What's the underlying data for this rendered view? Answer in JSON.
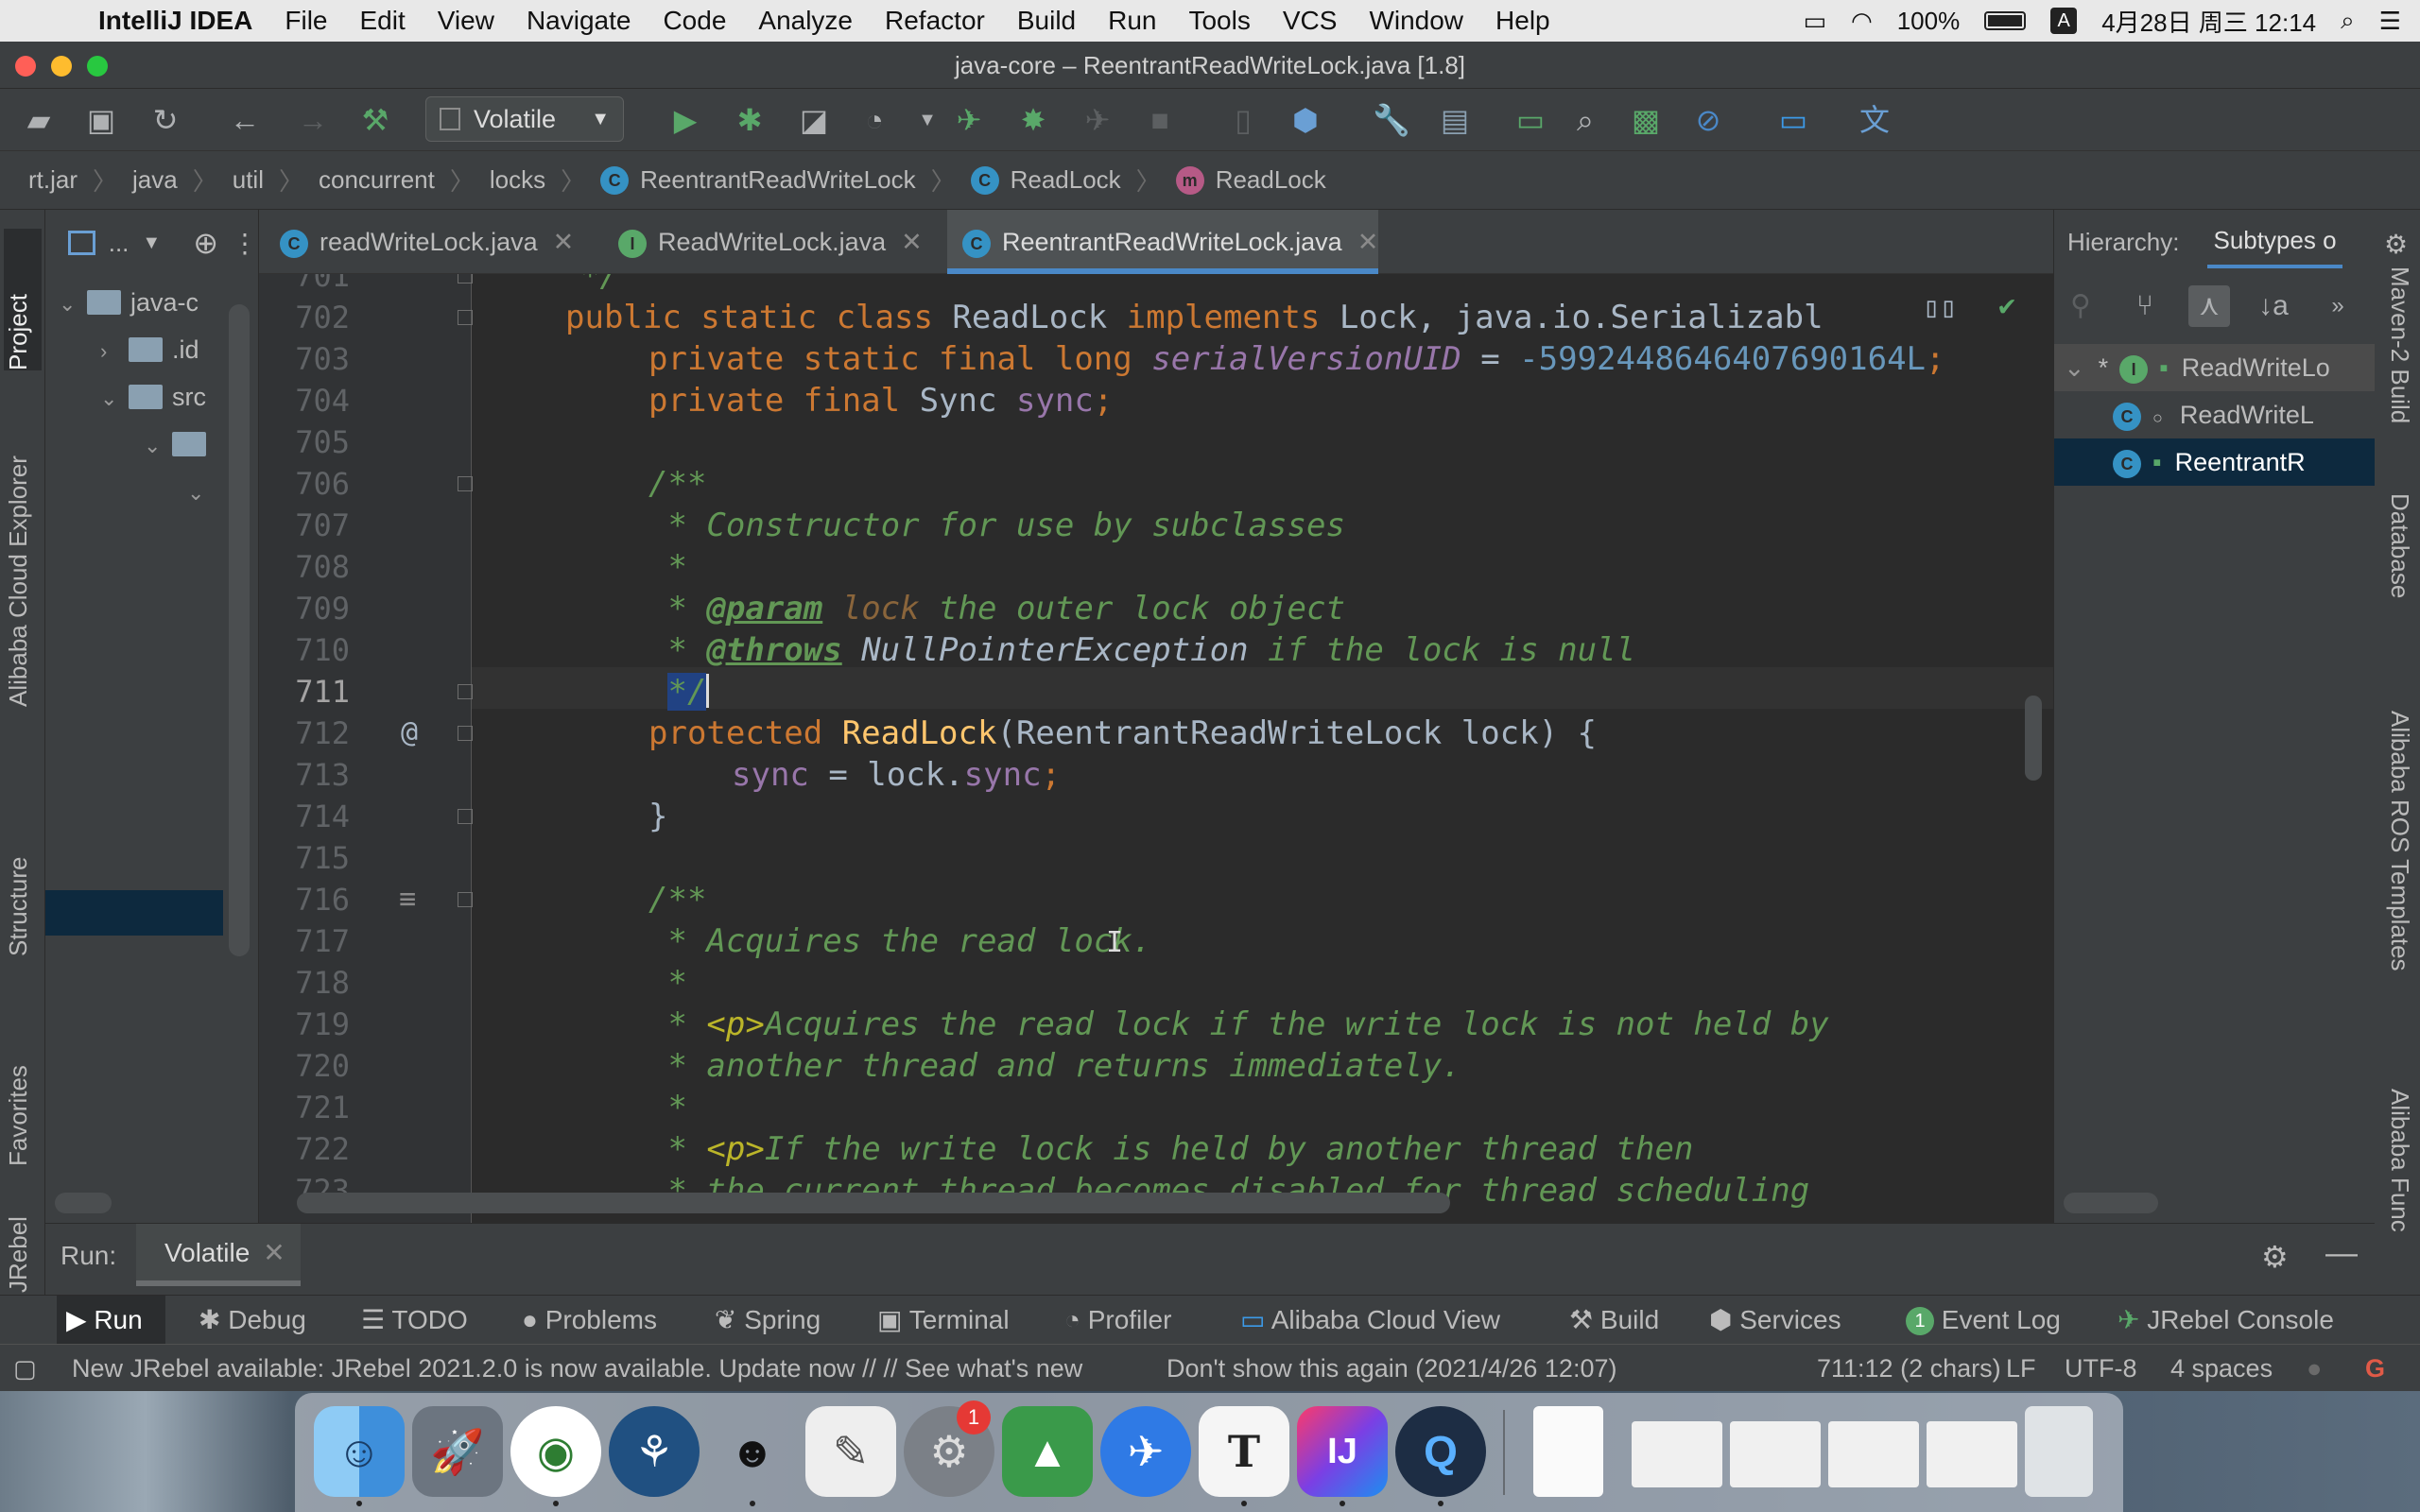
{
  "menubar": {
    "app_name": "IntelliJ IDEA",
    "items": [
      "File",
      "Edit",
      "View",
      "Navigate",
      "Code",
      "Analyze",
      "Refactor",
      "Build",
      "Run",
      "Tools",
      "VCS",
      "Window",
      "Help"
    ],
    "battery": "100%",
    "input_method": "A",
    "datetime": "4月28日 周三 12:14"
  },
  "window": {
    "title": "java-core – ReentrantReadWriteLock.java [1.8]"
  },
  "toolbar": {
    "run_config": "Volatile"
  },
  "breadcrumb": [
    "rt.jar",
    "java",
    "util",
    "concurrent",
    "locks",
    "ReentrantReadWriteLock",
    "ReadLock",
    "ReadLock"
  ],
  "left_tools": {
    "project": "Project",
    "alibaba_cloud_explorer": "Alibaba Cloud Explorer",
    "structure": "Structure",
    "favorites": "Favorites",
    "jrebel": "JRebel"
  },
  "project_panel": {
    "header": "...",
    "tree": [
      {
        "label": "java-c"
      },
      {
        "label": ".id"
      },
      {
        "label": "src"
      },
      {
        "label": ""
      },
      {
        "label": ""
      }
    ]
  },
  "editor_tabs": [
    {
      "label": "readWriteLock.java",
      "icon": "C"
    },
    {
      "label": "ReadWriteLock.java",
      "icon": "I"
    },
    {
      "label": "ReentrantReadWriteLock.java",
      "icon": "C"
    }
  ],
  "editor": {
    "line_numbers": [
      "701",
      "702",
      "703",
      "704",
      "705",
      "706",
      "707",
      "708",
      "709",
      "710",
      "711",
      "712",
      "713",
      "714",
      "715",
      "716",
      "717",
      "718",
      "719",
      "720",
      "721",
      "722",
      "723"
    ],
    "current_line": "711",
    "code": {
      "l701": "*/",
      "l702_a": "public static class ",
      "l702_b": "ReadLock ",
      "l702_c": "implements ",
      "l702_d": "Lock, java.io.Serializabl",
      "l703_a": "private static final long ",
      "l703_b": "serialVersionUID",
      "l703_c": " = ",
      "l703_d": "-5992448646407690164L",
      "l703_e": ";",
      "l704_a": "private final ",
      "l704_b": "Sync ",
      "l704_c": "sync",
      "l704_d": ";",
      "l706": "/**",
      "l707": " * Constructor for use by subclasses",
      "l708": " *",
      "l709_a": " * ",
      "l709_b": "@param",
      "l709_c": " lock",
      "l709_d": " the outer lock object",
      "l710_a": " * ",
      "l710_b": "@throws",
      "l710_c": " NullPointerException",
      "l710_d": " if the lock is null",
      "l711_a": " ",
      "l711_b": "*/",
      "l712_a": "protected ",
      "l712_b": "ReadLock",
      "l712_c": "(ReentrantReadWriteLock lock) {",
      "l713_a": "sync",
      "l713_b": " = lock.",
      "l713_c": "sync",
      "l713_d": ";",
      "l714": "}",
      "l716": "/**",
      "l717": " * Acquires the read lock.",
      "l718": " *",
      "l719_a": " * ",
      "l719_b": "<p>",
      "l719_c": "Acquires the read lock if the write lock is not held by",
      "l720": " * another thread and returns immediately.",
      "l721": " *",
      "l722_a": " * ",
      "l722_b": "<p>",
      "l722_c": "If the write lock is held by another thread then",
      "l723": " * the current thread becomes disabled for thread scheduling"
    },
    "gutter_marks": {
      "override": "@",
      "doc": "≡"
    }
  },
  "hierarchy": {
    "label": "Hierarchy:",
    "tab": "Subtypes o",
    "rows": [
      {
        "label": "ReadWriteLo",
        "icon": "I"
      },
      {
        "label": "ReadWriteL",
        "icon": "C"
      },
      {
        "label": "ReentrantR",
        "icon": "C"
      }
    ]
  },
  "right_tools": {
    "maven": "Maven-2 Build",
    "database": "Database",
    "ros": "Alibaba ROS Templates",
    "func": "Alibaba Func"
  },
  "run_bar": {
    "label": "Run:",
    "tab": "Volatile"
  },
  "bottom_tabs": [
    "Run",
    "Debug",
    "TODO",
    "Problems",
    "Spring",
    "Terminal",
    "Profiler",
    "Alibaba Cloud View",
    "Build",
    "Services",
    "Event Log",
    "JRebel Console"
  ],
  "event_log_count": "1",
  "status_bar": {
    "message": "New JRebel available: JRebel 2021.2.0 is now available. Update now // // See what's new",
    "dismiss": "Don't show this again (2021/4/26 12:07)",
    "position": "711:12 (2 chars)",
    "line_sep": "LF",
    "encoding": "UTF-8",
    "indent": "4 spaces"
  },
  "dock": {
    "apps": [
      "finder-icon",
      "launchpad-icon",
      "chrome-icon",
      "sourcetree-icon",
      "qq-icon",
      "text-edit-icon",
      "system-preferences-icon",
      "android-studio-icon",
      "lark-icon",
      "typora-icon",
      "intellij-icon",
      "quicktime-icon"
    ],
    "badge": "1",
    "typora_letter": "T",
    "intellij_letter": "IJ"
  },
  "colors": {
    "accent": "#4a88c7",
    "selection": "#0d293e",
    "keyword": "#cc7832",
    "comment": "#629755",
    "number": "#6897bb",
    "field": "#9876aa",
    "method": "#ffc66d"
  }
}
